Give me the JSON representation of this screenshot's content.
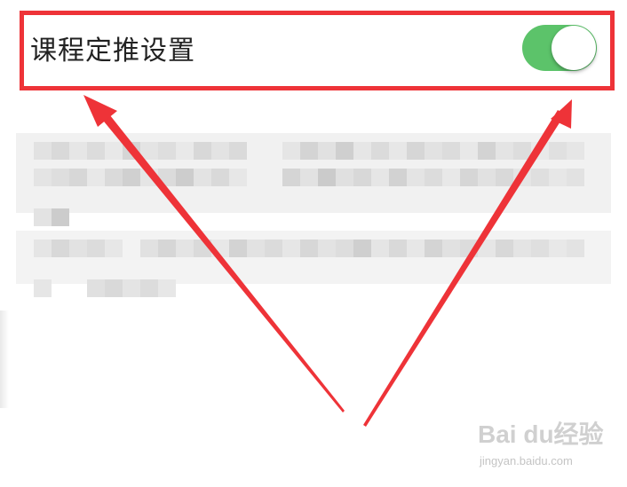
{
  "setting": {
    "label": "课程定推设置",
    "toggle_state": "on",
    "toggle_color": "#5cc36a"
  },
  "annotation": {
    "highlight_color": "#ee3338"
  },
  "watermark": {
    "main": "Bai du经验",
    "sub": "jingyan.baidu.com"
  }
}
